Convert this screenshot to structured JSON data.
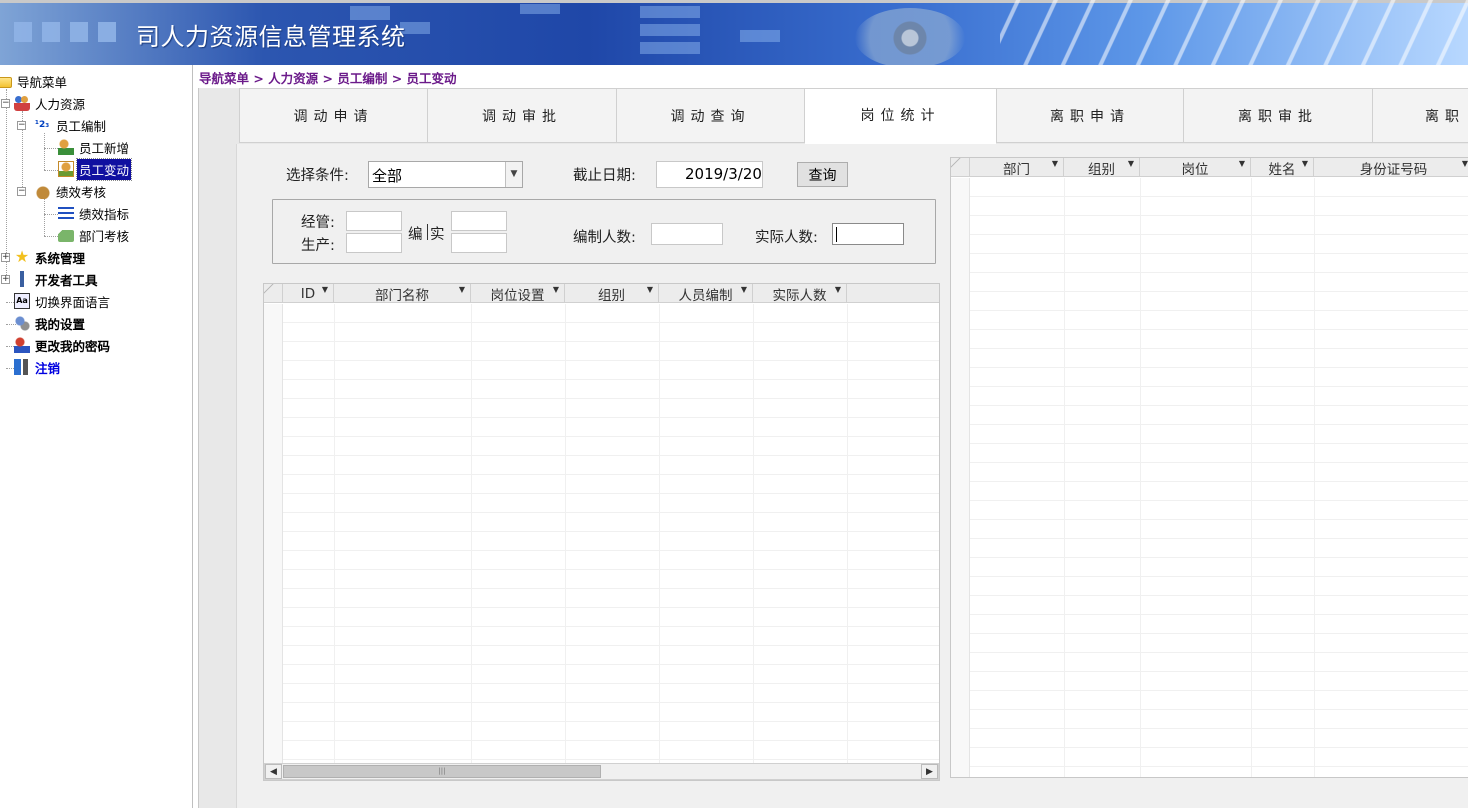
{
  "app": {
    "title": "司人力资源信息管理系统"
  },
  "breadcrumb": "导航菜单 > 人力资源 > 员工编制 > 员工变动",
  "sidebar": {
    "items": [
      {
        "label": "导航菜单",
        "icon": "folder-icon"
      },
      {
        "label": "人力资源",
        "icon": "people-icon"
      },
      {
        "label": "员工编制",
        "icon": "numbers-123-icon"
      },
      {
        "label": "员工新增",
        "icon": "user-add-icon"
      },
      {
        "label": "员工变动",
        "icon": "user-edit-icon",
        "selected": true
      },
      {
        "label": "绩效考核",
        "icon": "money-bag-icon"
      },
      {
        "label": "绩效指标",
        "icon": "list-icon"
      },
      {
        "label": "部门考核",
        "icon": "tag-icon"
      },
      {
        "label": "系统管理",
        "icon": "star-icon"
      },
      {
        "label": "开发者工具",
        "icon": "tools-icon"
      },
      {
        "label": "切换界面语言",
        "icon": "language-icon"
      },
      {
        "label": "我的设置",
        "icon": "settings-gear-icon"
      },
      {
        "label": "更改我的密码",
        "icon": "user-key-icon"
      },
      {
        "label": "注销",
        "icon": "logout-icon"
      }
    ]
  },
  "tabs": [
    {
      "label": "调动申请"
    },
    {
      "label": "调动审批"
    },
    {
      "label": "调动查询"
    },
    {
      "label": "岗位统计",
      "active": true
    },
    {
      "label": "离职申请"
    },
    {
      "label": "离职审批"
    },
    {
      "label": "离职"
    }
  ],
  "filter": {
    "condition_label": "选择条件:",
    "condition_value": "全部",
    "date_label": "截止日期:",
    "date_value": "2019/3/20",
    "query_button": "查询"
  },
  "stats": {
    "jingguan_label": "经管:",
    "shengchan_label": "生产:",
    "bian_label": "编",
    "shi_label": "实",
    "bianzhi_label": "编制人数:",
    "shiji_label": "实际人数:"
  },
  "left_grid": {
    "columns": [
      "ID",
      "部门名称",
      "岗位设置",
      "组别",
      "人员编制",
      "实际人数"
    ],
    "rows": []
  },
  "right_grid": {
    "columns": [
      "部门",
      "组别",
      "岗位",
      "姓名",
      "身份证号码"
    ],
    "rows": []
  }
}
